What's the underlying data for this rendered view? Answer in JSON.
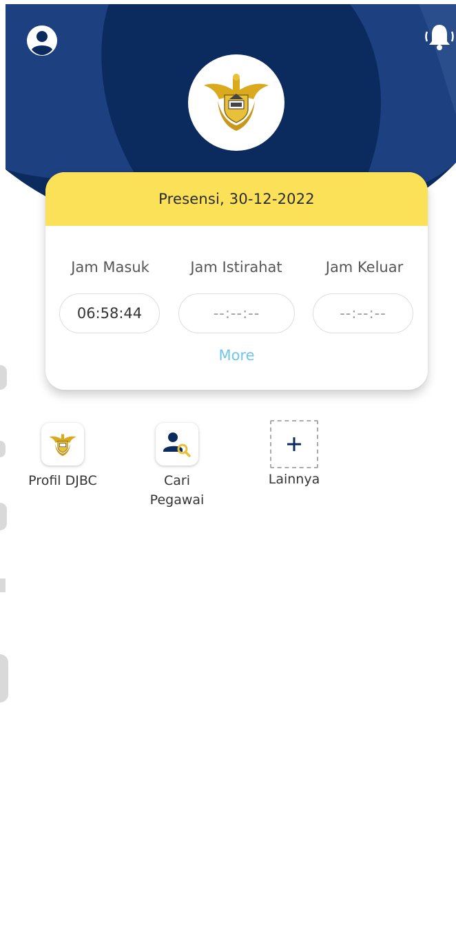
{
  "header": {
    "profile_icon": "user-circle-icon",
    "bell_icon": "bell-ringing-icon",
    "logo": "djbc-emblem",
    "colors": {
      "navy": "#0b2b5e",
      "navy_light": "#1d4080",
      "accent_yellow": "#fbe157",
      "link_blue": "#6ec6e8"
    }
  },
  "card": {
    "title": "Presensi, 30-12-2022",
    "columns": [
      {
        "label": "Jam Masuk",
        "value": "06:58:44"
      },
      {
        "label": "Jam Istirahat",
        "value": "--:--:--"
      },
      {
        "label": "Jam Keluar",
        "value": "--:--:--"
      }
    ],
    "more_label": "More"
  },
  "shortcuts": [
    {
      "label": "Profil DJBC",
      "icon": "djbc-emblem-icon"
    },
    {
      "label": "Cari\nPegawai",
      "icon": "user-search-icon"
    },
    {
      "label": "Lainnya",
      "icon": "plus-icon"
    }
  ]
}
